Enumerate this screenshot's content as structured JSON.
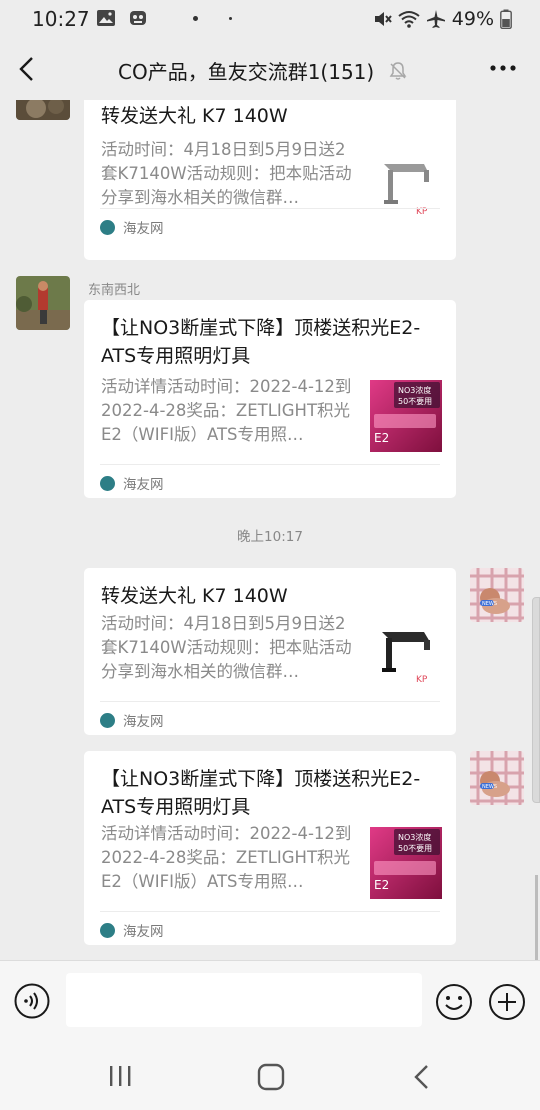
{
  "status_bar": {
    "time": "10:27",
    "battery": "49%",
    "icons": [
      "gallery-icon",
      "app-icon",
      "mute-icon",
      "wifi-icon",
      "airplane-icon",
      "battery-icon"
    ]
  },
  "header": {
    "title": "CO产品，鱼友交流群1(151)",
    "back_icon": "back-arrow-icon",
    "mute_icon": "bell-off-icon",
    "more_icon": "more-icon"
  },
  "messages": [
    {
      "side": "left",
      "sender": "",
      "title": "转发送大礼 K7 140W",
      "desc": "活动时间：4月18日到5月9日送2套K7140W活动规则：把本贴活动分享到海水相关的微信群…",
      "thumb": "lamp-k7-thumbnail",
      "source": "海友网"
    },
    {
      "side": "left",
      "sender": "东南西北",
      "title": "【让NO3断崖式下降】顶楼送积光E2-ATS专用照明灯具",
      "desc": "活动详情活动时间：2022-4-12到2022-4-28奖品：ZETLIGHT积光E2（WIFI版）ATS专用照…",
      "thumb": "e2-light-thumbnail",
      "thumb_text": "NO3浓度\n50不要用",
      "source": "海友网"
    },
    {
      "side": "right",
      "sender": "",
      "title": "转发送大礼 K7 140W",
      "desc": "活动时间：4月18日到5月9日送2套K7140W活动规则：把本贴活动分享到海水相关的微信群…",
      "thumb": "lamp-k7-thumbnail",
      "source": "海友网"
    },
    {
      "side": "right",
      "sender": "",
      "title": "【让NO3断崖式下降】顶楼送积光E2-ATS专用照明灯具",
      "desc": "活动详情活动时间：2022-4-12到2022-4-28奖品：ZETLIGHT积光E2（WIFI版）ATS专用照…",
      "thumb": "e2-light-thumbnail",
      "thumb_text": "NO3浓度\n50不要用",
      "source": "海友网"
    }
  ],
  "timestamp": "晚上10:17",
  "input_bar": {
    "placeholder": "",
    "voice_icon": "voice-icon",
    "emoji_icon": "emoji-icon",
    "plus_icon": "plus-icon"
  },
  "colors": {
    "background": "#ededed",
    "card": "#ffffff",
    "source_icon": "#2d7e86",
    "thumb_magenta": "#d6246e"
  }
}
